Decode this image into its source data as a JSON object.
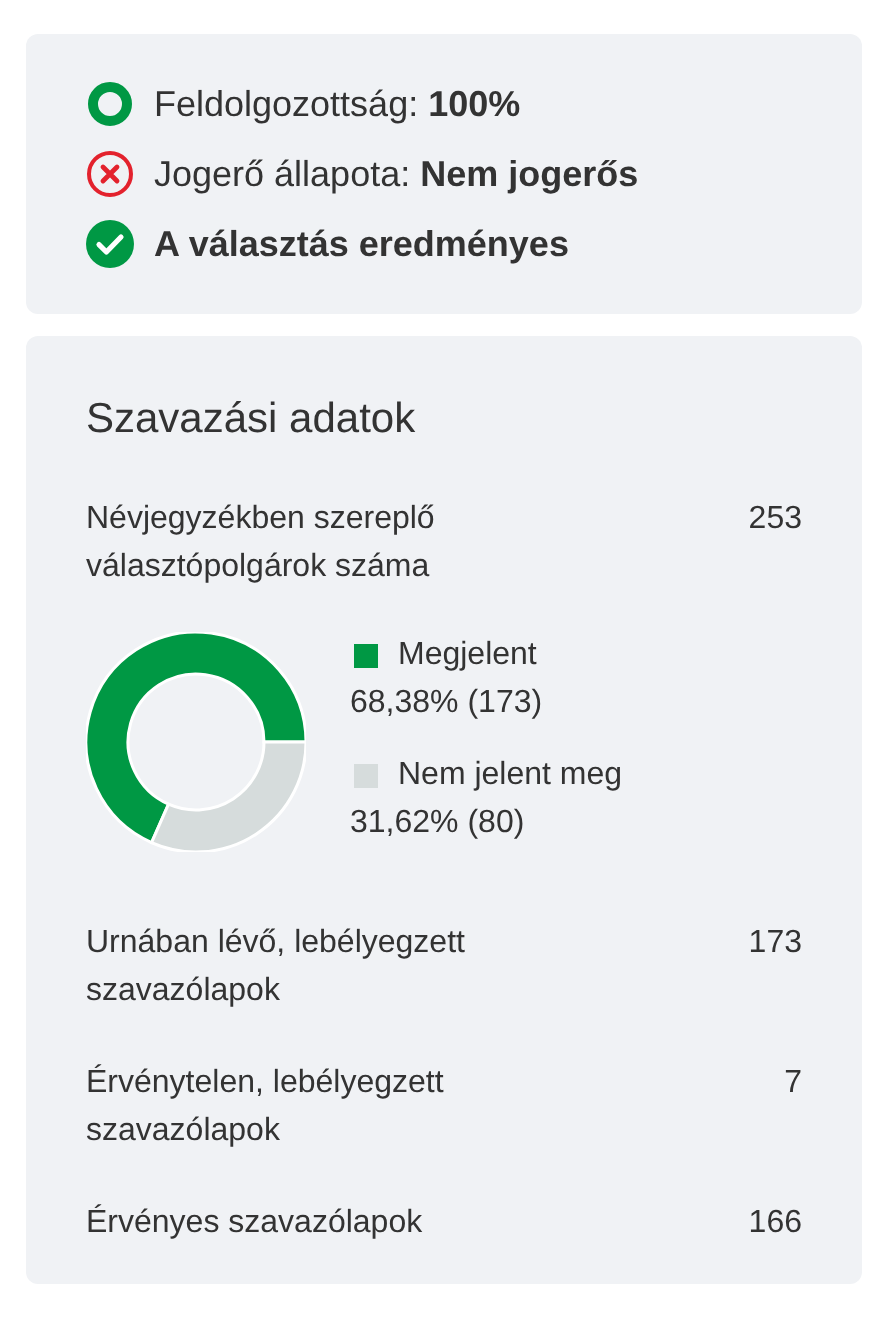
{
  "status": [
    {
      "kind": "progress",
      "text": "Feldolgozottság: **100%**"
    },
    {
      "kind": "error",
      "text": "Jogerő állapota: **Nem jogerős**"
    },
    {
      "kind": "success",
      "text": "A választás eredményes"
    }
  ],
  "voting": {
    "title": "Szavazási adatok",
    "rows_top": [
      {
        "label": "Névjegyzékben szereplő választópolgárok száma",
        "value": "253"
      }
    ],
    "turnout": {
      "chart_data": {
        "type": "donut",
        "categories": [
          "Megjelent",
          "Nem jelent meg"
        ],
        "values": [
          68.38,
          31.62
        ]
      },
      "legend": [
        {
          "color": "#009844",
          "detail": "68,38% (173)"
        },
        {
          "color": "#d6dcdc",
          "detail": "31,62% (80)"
        }
      ]
    },
    "rows": [
      {
        "label": "Urnában lévő, lebélyegzett szavazólapok",
        "value": "173"
      },
      {
        "label": "Érvénytelen, lebélyegzett szavazólapok",
        "value": "7"
      },
      {
        "label": "Érvényes szavazólapok",
        "value": "166"
      }
    ]
  }
}
